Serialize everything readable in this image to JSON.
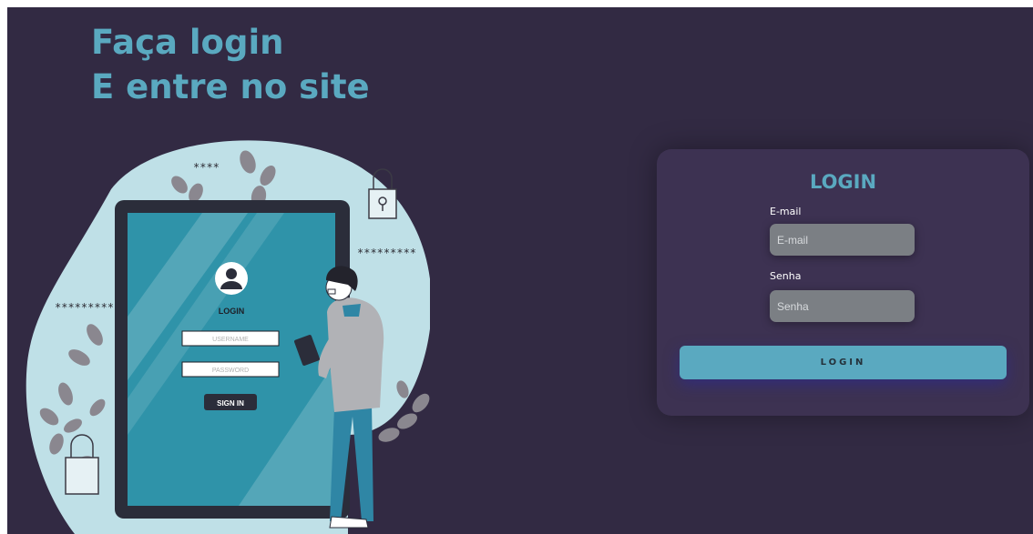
{
  "hero": {
    "line1": "Faça login",
    "line2": "E entre no site"
  },
  "illustration": {
    "stars_top": "****",
    "stars_left": "*********",
    "stars_right": "*********",
    "tablet_login_title": "LOGIN",
    "tablet_username_placeholder": "USERNAME",
    "tablet_password_placeholder": "PASSWORD",
    "tablet_signin_label": "SIGN IN"
  },
  "login_card": {
    "title": "LOGIN",
    "email_label": "E-mail",
    "email_placeholder": "E-mail",
    "password_label": "Senha",
    "password_placeholder": "Senha",
    "submit_label": "LOGIN"
  },
  "colors": {
    "background": "#322a43",
    "card": "#3d3252",
    "accent": "#5aa9c0",
    "input": "#7b7f84"
  }
}
